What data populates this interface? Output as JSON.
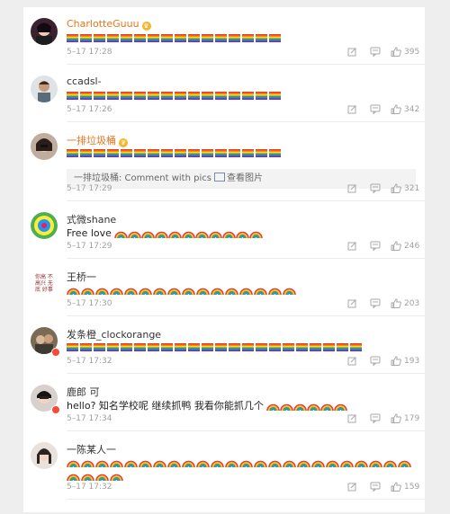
{
  "comments": [
    {
      "name": "CharlotteGuuu",
      "name_color": "orange",
      "crown": true,
      "content_type": "flags",
      "flag_count": 16,
      "time": "5–17 17:28",
      "likes": "395"
    },
    {
      "name": "ccadsl-",
      "name_color": "normal",
      "crown": false,
      "content_type": "flags",
      "flag_count": 16,
      "time": "5–17 17:26",
      "likes": "342"
    },
    {
      "name": "一排垃圾桶",
      "name_color": "orange",
      "crown": true,
      "content_type": "flags",
      "flag_count": 16,
      "attachment": {
        "prefix": "一排垃圾桶: Comment with pics",
        "link": "查看图片"
      },
      "time": "5–17 17:29",
      "likes": "321"
    },
    {
      "name": "式微shane",
      "name_color": "normal",
      "crown": false,
      "content_type": "text_rainbows",
      "text": "Free love",
      "rainbow_count": 11,
      "time": "5–17 17:29",
      "likes": "246"
    },
    {
      "name": "王桥一",
      "name_color": "normal",
      "crown": false,
      "content_type": "rainbows",
      "rainbow_count": 16,
      "time": "5–17 17:30",
      "likes": "203"
    },
    {
      "name": "发条橙_clockorange",
      "name_color": "normal",
      "crown": false,
      "badge": true,
      "content_type": "flags",
      "flag_count": 22,
      "time": "5–17 17:32",
      "likes": "193"
    },
    {
      "name": "鹿郎 可",
      "name_color": "normal",
      "crown": false,
      "badge": true,
      "content_type": "text_rainbows",
      "text": "hello? 知名学校呢 继续抓鸭 我看你能抓几个",
      "rainbow_count": 6,
      "time": "5–17 17:34",
      "likes": "179"
    },
    {
      "name": "一陈某人一",
      "name_color": "normal",
      "crown": false,
      "content_type": "rainbows",
      "rainbow_count": 28,
      "time": "5–17 17:32",
      "likes": "159"
    }
  ],
  "colors": {
    "accent_orange": "#e8741e",
    "meta_gray": "#a0a0a0",
    "badge_red": "#f54a34"
  },
  "icons": {
    "edit": "edit-icon",
    "reply": "reply-icon",
    "like": "thumbs-up-icon",
    "pic": "picture-icon"
  }
}
